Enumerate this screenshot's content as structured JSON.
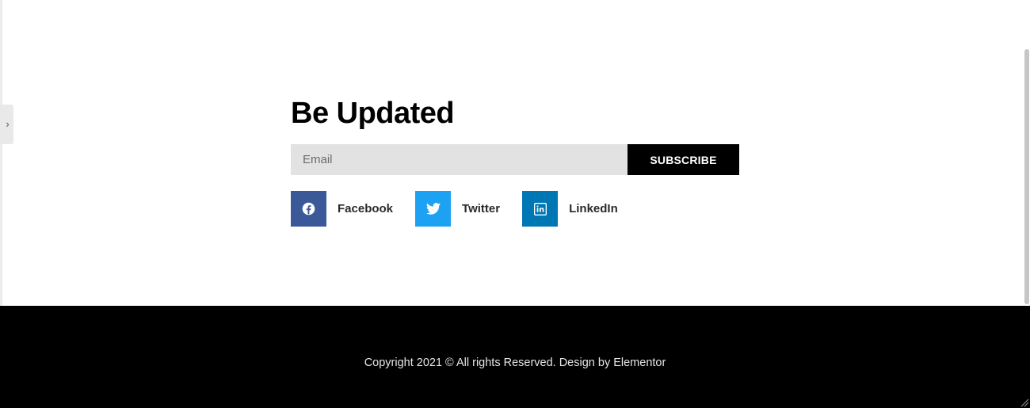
{
  "newsletter": {
    "title": "Be Updated",
    "email_placeholder": "Email",
    "subscribe_label": "SUBSCRIBE"
  },
  "share": {
    "items": [
      {
        "label": "Facebook",
        "icon": "facebook-icon",
        "color": "#3b5998"
      },
      {
        "label": "Twitter",
        "icon": "twitter-icon",
        "color": "#1da1f2"
      },
      {
        "label": "LinkedIn",
        "icon": "linkedin-icon",
        "color": "#0077b5"
      }
    ]
  },
  "footer": {
    "copyright": "Copyright 2021 © All rights Reserved. Design by Elementor"
  },
  "colors": {
    "input_bg": "#e2e2e2",
    "button_bg": "#000000",
    "footer_bg": "#000000"
  }
}
